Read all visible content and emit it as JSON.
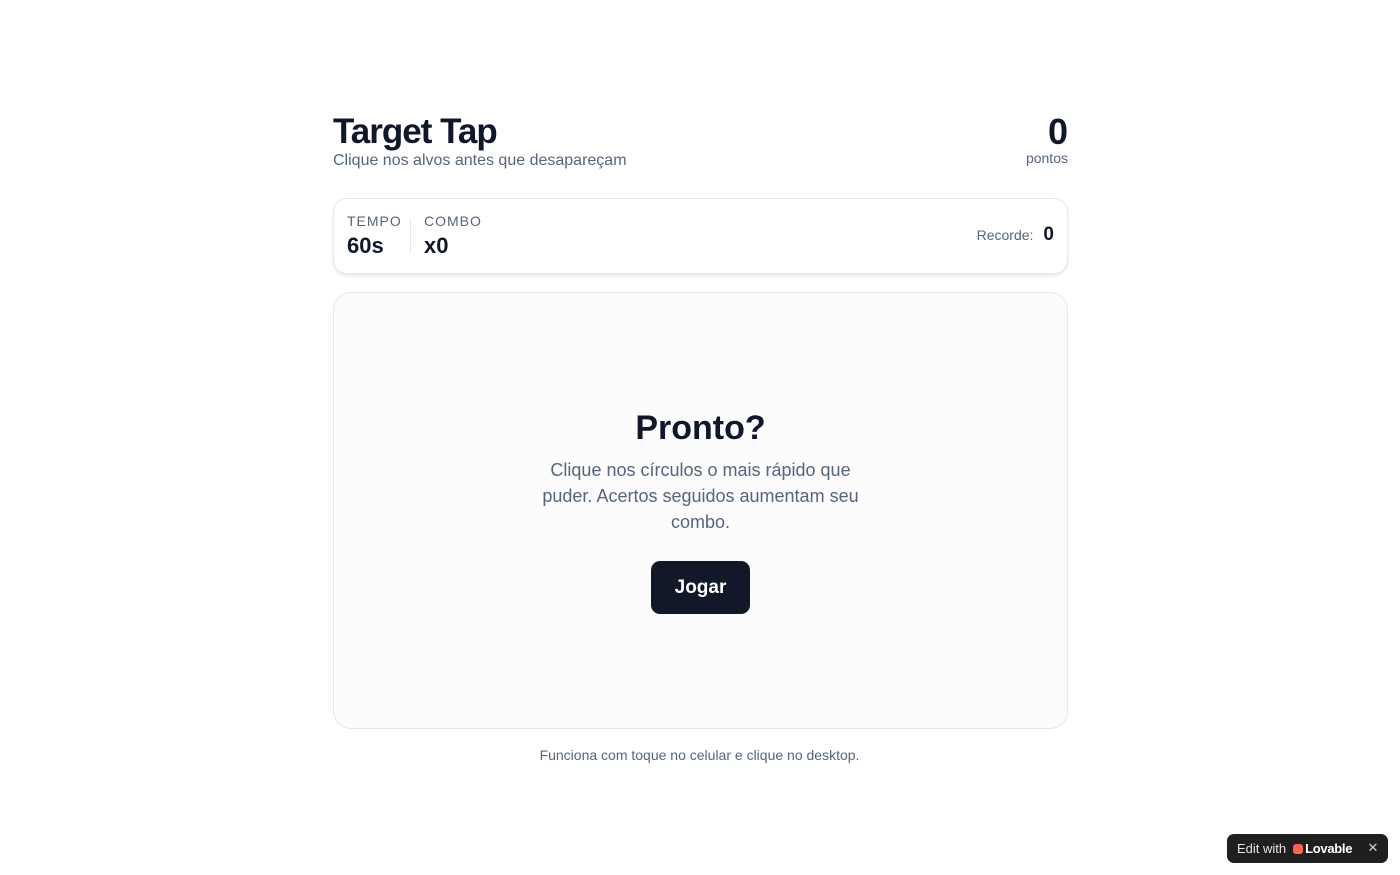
{
  "header": {
    "title": "Target Tap",
    "subtitle": "Clique nos alvos antes que desapareçam",
    "score_value": "0",
    "score_label": "pontos"
  },
  "stats": {
    "time_label": "TEMPO",
    "time_value": "60s",
    "combo_label": "COMBO",
    "combo_value": "x0",
    "record_label": "Recorde:",
    "record_value": "0"
  },
  "arena": {
    "ready_title": "Pronto?",
    "ready_text": "Clique nos círculos o mais rápido que puder. Acertos seguidos aumentam seu combo.",
    "play_label": "Jogar"
  },
  "footer": {
    "note": "Funciona com toque no celular e clique no desktop."
  },
  "badge": {
    "text": "Edit with",
    "brand": "Lovable",
    "close": "✕"
  },
  "colors": {
    "primary_button": "#111827",
    "text_primary": "#0f172a",
    "text_muted": "#55657d",
    "border": "#e5e7eb"
  }
}
